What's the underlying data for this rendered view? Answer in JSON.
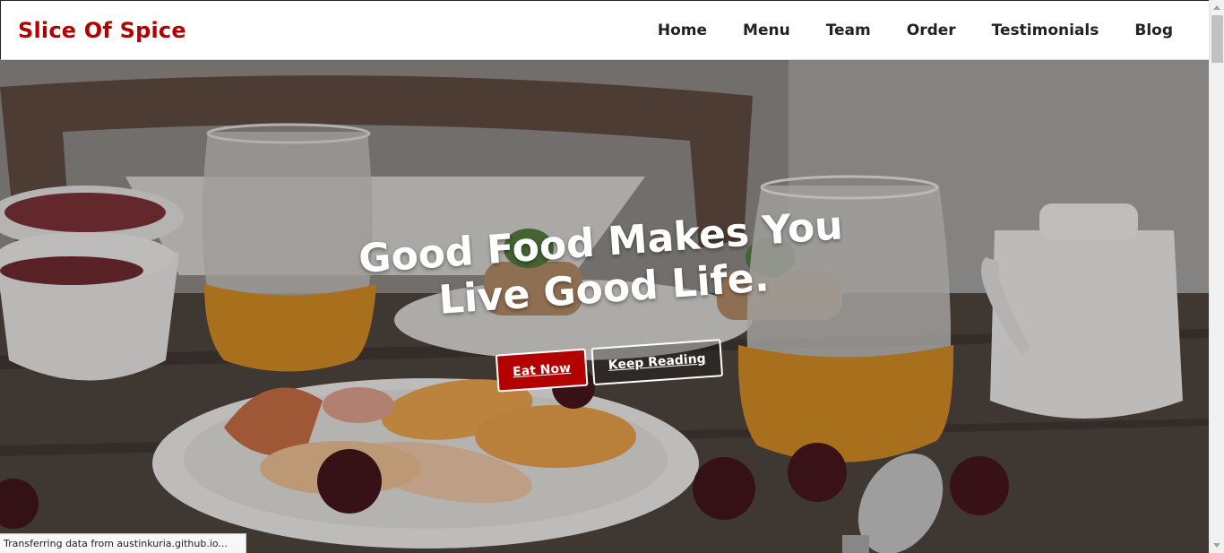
{
  "brand": {
    "name": "Slice Of Spice"
  },
  "nav": {
    "items": [
      {
        "label": "Home"
      },
      {
        "label": "Menu"
      },
      {
        "label": "Team"
      },
      {
        "label": "Order"
      },
      {
        "label": "Testimonials"
      },
      {
        "label": "Blog"
      }
    ]
  },
  "hero": {
    "title": "Good Food Makes You Live Good Life.",
    "primary_cta": "Eat Now",
    "secondary_cta": "Keep Reading"
  },
  "status_bar": {
    "text": "Transferring data from austinkuria.github.io..."
  },
  "colors": {
    "accent": "#b30000",
    "nav_text": "#222222",
    "hero_text": "#ffffff"
  }
}
